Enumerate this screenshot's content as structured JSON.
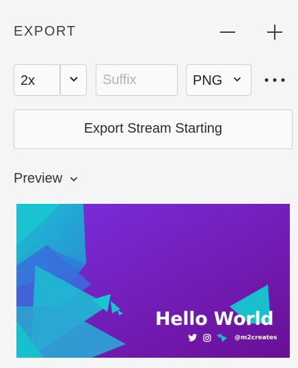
{
  "panel": {
    "title": "EXPORT"
  },
  "export_settings": {
    "scale": "2x",
    "suffix_value": "",
    "suffix_placeholder": "Suffix",
    "format": "PNG"
  },
  "export_button": {
    "label": "Export Stream Starting"
  },
  "preview": {
    "label": "Preview",
    "image": {
      "heading": "Hello World",
      "handle": "@m2creates",
      "colors": {
        "gradient_start": "#7b2fe0",
        "gradient_end": "#6a0f96",
        "accent": "#12c6cf"
      }
    }
  },
  "icons": {
    "remove": "minus-icon",
    "add": "plus-icon",
    "more": "more-horizontal-icon",
    "dropdown": "chevron-down-icon",
    "social": [
      "twitter-icon",
      "instagram-icon",
      "twitch-icon"
    ]
  }
}
